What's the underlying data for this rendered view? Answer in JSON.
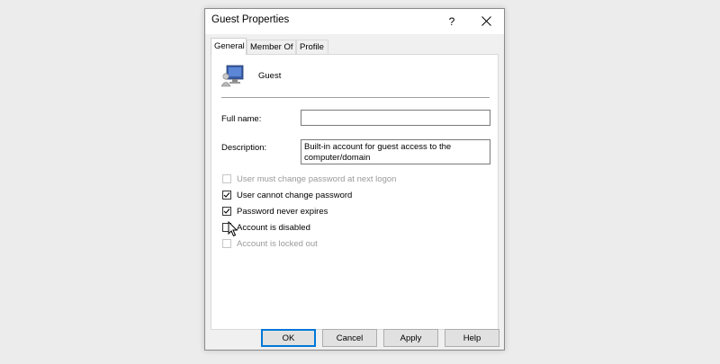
{
  "window": {
    "title": "Guest Properties",
    "help_label": "?"
  },
  "tabs": [
    {
      "label": "General",
      "active": true
    },
    {
      "label": "Member Of",
      "active": false
    },
    {
      "label": "Profile",
      "active": false
    }
  ],
  "user": {
    "name": "Guest",
    "icon": "user-monitor-icon"
  },
  "fields": {
    "full_name_label": "Full name:",
    "full_name_value": "",
    "description_label": "Description:",
    "description_value": "Built-in account for guest access to the computer/domain"
  },
  "checkboxes": [
    {
      "label": "User must change password at next logon",
      "checked": false,
      "enabled": false
    },
    {
      "label": "User cannot change password",
      "checked": true,
      "enabled": true
    },
    {
      "label": "Password never expires",
      "checked": true,
      "enabled": true
    },
    {
      "label": "Account is disabled",
      "checked": false,
      "enabled": true
    },
    {
      "label": "Account is locked out",
      "checked": false,
      "enabled": false
    }
  ],
  "buttons": {
    "ok": "OK",
    "cancel": "Cancel",
    "apply": "Apply",
    "help": "Help"
  },
  "colors": {
    "default_button_border": "#0078d7",
    "disabled_text": "#9a9a9a"
  }
}
